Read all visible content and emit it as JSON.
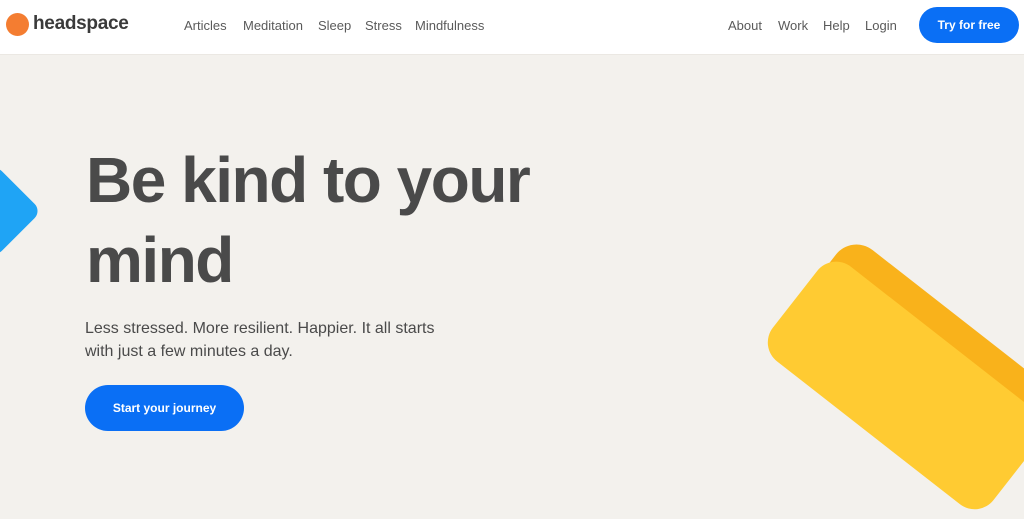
{
  "brand": {
    "name": "headspace",
    "logo_color": "#f47d31"
  },
  "nav": {
    "primary": [
      "Articles",
      "Meditation",
      "Sleep",
      "Stress",
      "Mindfulness"
    ],
    "secondary": [
      "About",
      "Work",
      "Help",
      "Login"
    ],
    "cta_label": "Try for free"
  },
  "hero": {
    "title": "Be kind to your mind",
    "subtitle": "Less stressed. More resilient. Happier. It all starts with just a few minutes a day.",
    "cta_label": "Start your journey"
  },
  "colors": {
    "accent": "#0a6ff5",
    "background": "#f3f1ed",
    "shape_blue": "#1fa4f5",
    "shape_yellow": "#ffcb32",
    "shape_yellow_dark": "#f9b21b"
  }
}
